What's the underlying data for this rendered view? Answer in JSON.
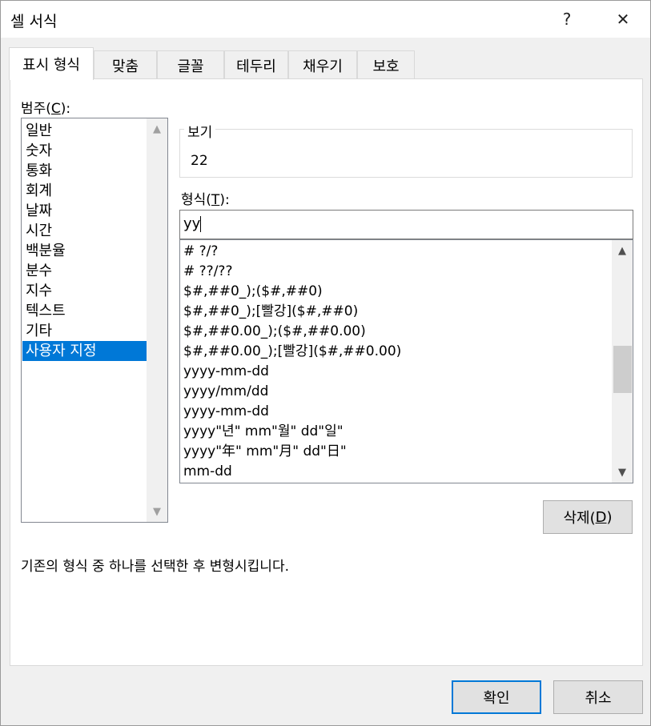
{
  "window": {
    "title": "셀 서식",
    "help_label": "?",
    "close_label": "✕"
  },
  "tabs": [
    {
      "label": "표시 형식",
      "active": true
    },
    {
      "label": "맞춤"
    },
    {
      "label": "글꼴"
    },
    {
      "label": "테두리"
    },
    {
      "label": "채우기"
    },
    {
      "label": "보호"
    }
  ],
  "category": {
    "label_prefix": "범주(",
    "label_key": "C",
    "label_suffix": "):",
    "items": [
      "일반",
      "숫자",
      "통화",
      "회계",
      "날짜",
      "시간",
      "백분율",
      "분수",
      "지수",
      "텍스트",
      "기타",
      "사용자 지정"
    ],
    "selected": "사용자 지정"
  },
  "preview": {
    "legend": "보기",
    "value": "22"
  },
  "format": {
    "label_prefix": "형식(",
    "label_key": "T",
    "label_suffix": "):",
    "input_value": "yy",
    "items": [
      "# ?/?",
      "# ??/??",
      "$#,##0_);($#,##0)",
      "$#,##0_);[빨강]($#,##0)",
      "$#,##0.00_);($#,##0.00)",
      "$#,##0.00_);[빨강]($#,##0.00)",
      "yyyy-mm-dd",
      "yyyy/mm/dd",
      "yyyy-mm-dd",
      "yyyy\"년\" mm\"월\" dd\"일\"",
      "yyyy\"年\" mm\"月\" dd\"日\"",
      "mm-dd"
    ]
  },
  "delete_button": {
    "label_prefix": "삭제(",
    "label_key": "D",
    "label_suffix": ")"
  },
  "description": "기존의 형식 중 하나를 선택한 후 변형시킵니다.",
  "footer": {
    "ok_label": "확인",
    "cancel_label": "취소"
  },
  "icons": {
    "scroll_up": "chevron-up-icon",
    "scroll_down": "chevron-down-icon",
    "close": "close-icon"
  },
  "colors": {
    "selection": "#0078d7",
    "panel": "#ffffff",
    "dialog_bg": "#f0f0f0"
  }
}
